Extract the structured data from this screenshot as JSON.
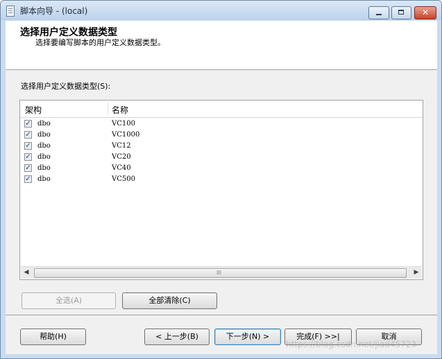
{
  "window": {
    "title": "脚本向导 - (local)"
  },
  "header": {
    "title": "选择用户定义数据类型",
    "description": "选择要编写脚本的用户定义数据类型。"
  },
  "list": {
    "label": "选择用户定义数据类型(S):",
    "columns": [
      "架构",
      "名称"
    ],
    "rows": [
      {
        "checked": true,
        "schema": "dbo",
        "name": "VC100"
      },
      {
        "checked": true,
        "schema": "dbo",
        "name": "VC1000"
      },
      {
        "checked": true,
        "schema": "dbo",
        "name": "VC12"
      },
      {
        "checked": true,
        "schema": "dbo",
        "name": "VC20"
      },
      {
        "checked": true,
        "schema": "dbo",
        "name": "VC40"
      },
      {
        "checked": true,
        "schema": "dbo",
        "name": "VC500"
      }
    ],
    "scroll_grip": "III"
  },
  "buttons": {
    "select_all": "全选(A)",
    "clear_all": "全部清除(C)",
    "help": "帮助(H)",
    "back": "< 上一步(B)",
    "next": "下一步(N) >",
    "finish": "完成(F) >>|",
    "cancel": "取消"
  },
  "watermark": "https://blog.csdn.net/jiad45723",
  "icons": {
    "app": "script-document-icon",
    "minimize": "minimize-icon",
    "maximize": "maximize-icon",
    "close": "close-icon",
    "check": "checkmark-icon"
  }
}
